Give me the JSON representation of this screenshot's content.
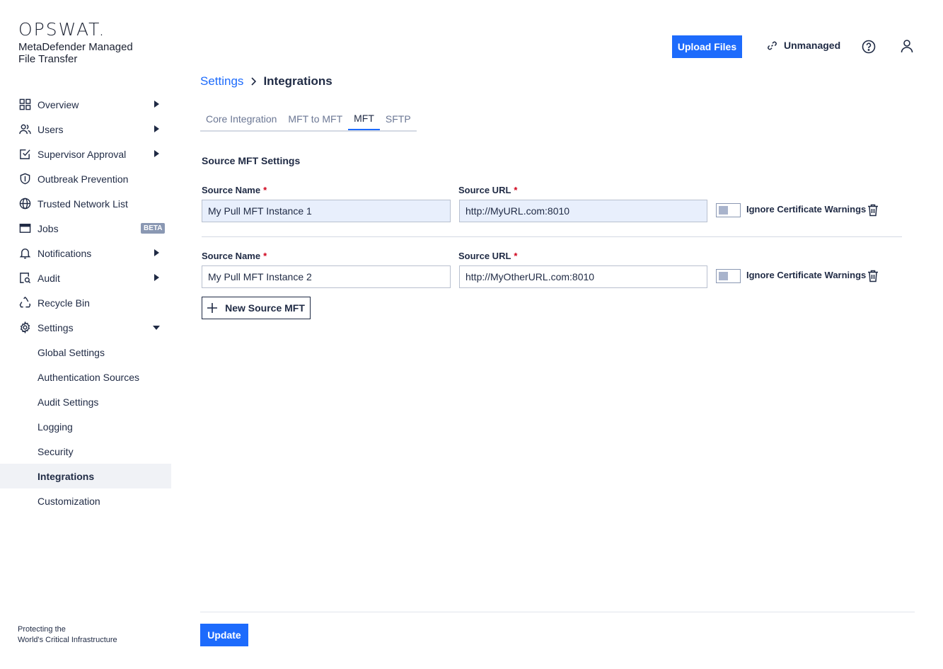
{
  "brand": {
    "logo": "OPSWAT.",
    "product_line1": "MetaDefender Managed",
    "product_line2": "File Transfer"
  },
  "sidebar": {
    "items": [
      {
        "label": "Overview",
        "icon": "grid-icon"
      },
      {
        "label": "Users",
        "icon": "users-icon"
      },
      {
        "label": "Supervisor Approval",
        "icon": "approval-check-icon"
      },
      {
        "label": "Outbreak Prevention",
        "icon": "shield-icon"
      },
      {
        "label": "Trusted Network List",
        "icon": "globe-icon"
      },
      {
        "label": "Jobs",
        "icon": "window-icon",
        "badge": "BETA"
      },
      {
        "label": "Notifications",
        "icon": "bell-icon"
      },
      {
        "label": "Audit",
        "icon": "audit-search-icon"
      },
      {
        "label": "Recycle Bin",
        "icon": "recycle-icon"
      },
      {
        "label": "Settings",
        "icon": "gear-icon"
      }
    ],
    "settings_subitems": [
      "Global Settings",
      "Authentication Sources",
      "Audit Settings",
      "Logging",
      "Security",
      "Integrations",
      "Customization"
    ],
    "tagline_line1": "Protecting the",
    "tagline_line2": "World's Critical Infrastructure"
  },
  "header": {
    "upload_label": "Upload Files",
    "unmanaged_label": "Unmanaged",
    "accent_color": "#1d6bfc"
  },
  "breadcrumb": {
    "parent": "Settings",
    "current": "Integrations"
  },
  "tabs": [
    "Core Integration",
    "MFT to MFT",
    "MFT",
    "SFTP"
  ],
  "active_tab": "MFT",
  "main": {
    "section_title": "Source MFT Settings",
    "sources": [
      {
        "name_label": "Source Name",
        "name_value": "My Pull MFT Instance 1",
        "url_label": "Source URL",
        "url_value": "http://MyURL.com:8010",
        "toggle_label": "Ignore Certificate Warnings"
      },
      {
        "name_label": "Source Name",
        "name_value": "My Pull MFT Instance 2",
        "url_label": "Source URL",
        "url_value": "http://MyOtherURL.com:8010",
        "toggle_label": "Ignore Certificate Warnings"
      }
    ],
    "required_mark": "*",
    "new_source_label": "New Source MFT",
    "update_label": "Update"
  }
}
